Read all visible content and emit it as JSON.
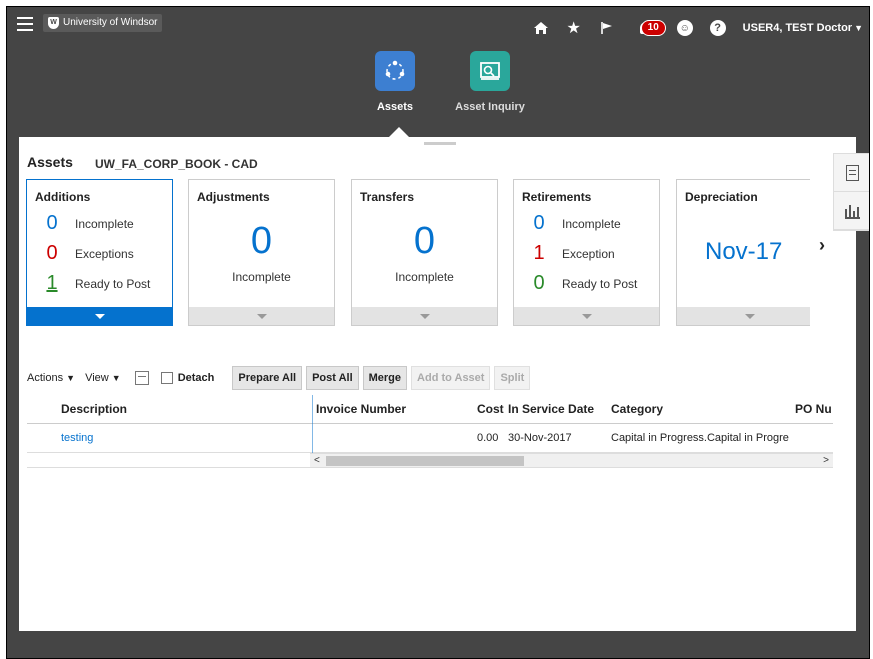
{
  "header": {
    "logo_text": "University of Windsor",
    "notifications_count": "10",
    "user_name": "USER4, TEST Doctor",
    "icons": [
      "menu-icon",
      "home-icon",
      "star-icon",
      "flag-icon",
      "bell-icon",
      "accessibility-icon",
      "help-icon"
    ]
  },
  "apps": [
    {
      "label": "Assets",
      "color": "#3d7fd1"
    },
    {
      "label": "Asset Inquiry",
      "color": "#2aa79b"
    }
  ],
  "page": {
    "title": "Assets",
    "book": "UW_FA_CORP_BOOK - CAD"
  },
  "cards": {
    "additions": {
      "title": "Additions",
      "rows": [
        {
          "num": "0",
          "label": "Incomplete"
        },
        {
          "num": "0",
          "label": "Exceptions"
        },
        {
          "num": "1",
          "label": "Ready to Post"
        }
      ]
    },
    "adjustments": {
      "title": "Adjustments",
      "num": "0",
      "label": "Incomplete"
    },
    "transfers": {
      "title": "Transfers",
      "num": "0",
      "label": "Incomplete"
    },
    "retirements": {
      "title": "Retirements",
      "rows": [
        {
          "num": "0",
          "label": "Incomplete"
        },
        {
          "num": "1",
          "label": "Exception"
        },
        {
          "num": "0",
          "label": "Ready to Post"
        }
      ]
    },
    "depreciation": {
      "title": "Depreciation",
      "period": "Nov-17"
    }
  },
  "toolbar": {
    "actions": "Actions",
    "view": "View",
    "detach": "Detach",
    "prepare_all": "Prepare All",
    "post_all": "Post All",
    "merge": "Merge",
    "add_to_asset": "Add to Asset",
    "split": "Split"
  },
  "table": {
    "columns": {
      "description": "Description",
      "invoice": "Invoice Number",
      "cost": "Cost",
      "in_service": "In Service Date",
      "category": "Category",
      "po": "PO Nu"
    },
    "rows": [
      {
        "description": "testing",
        "invoice": "",
        "cost": "0.00",
        "in_service": "30-Nov-2017",
        "category": "Capital in Progress.Capital in Progres",
        "po": ""
      }
    ]
  }
}
